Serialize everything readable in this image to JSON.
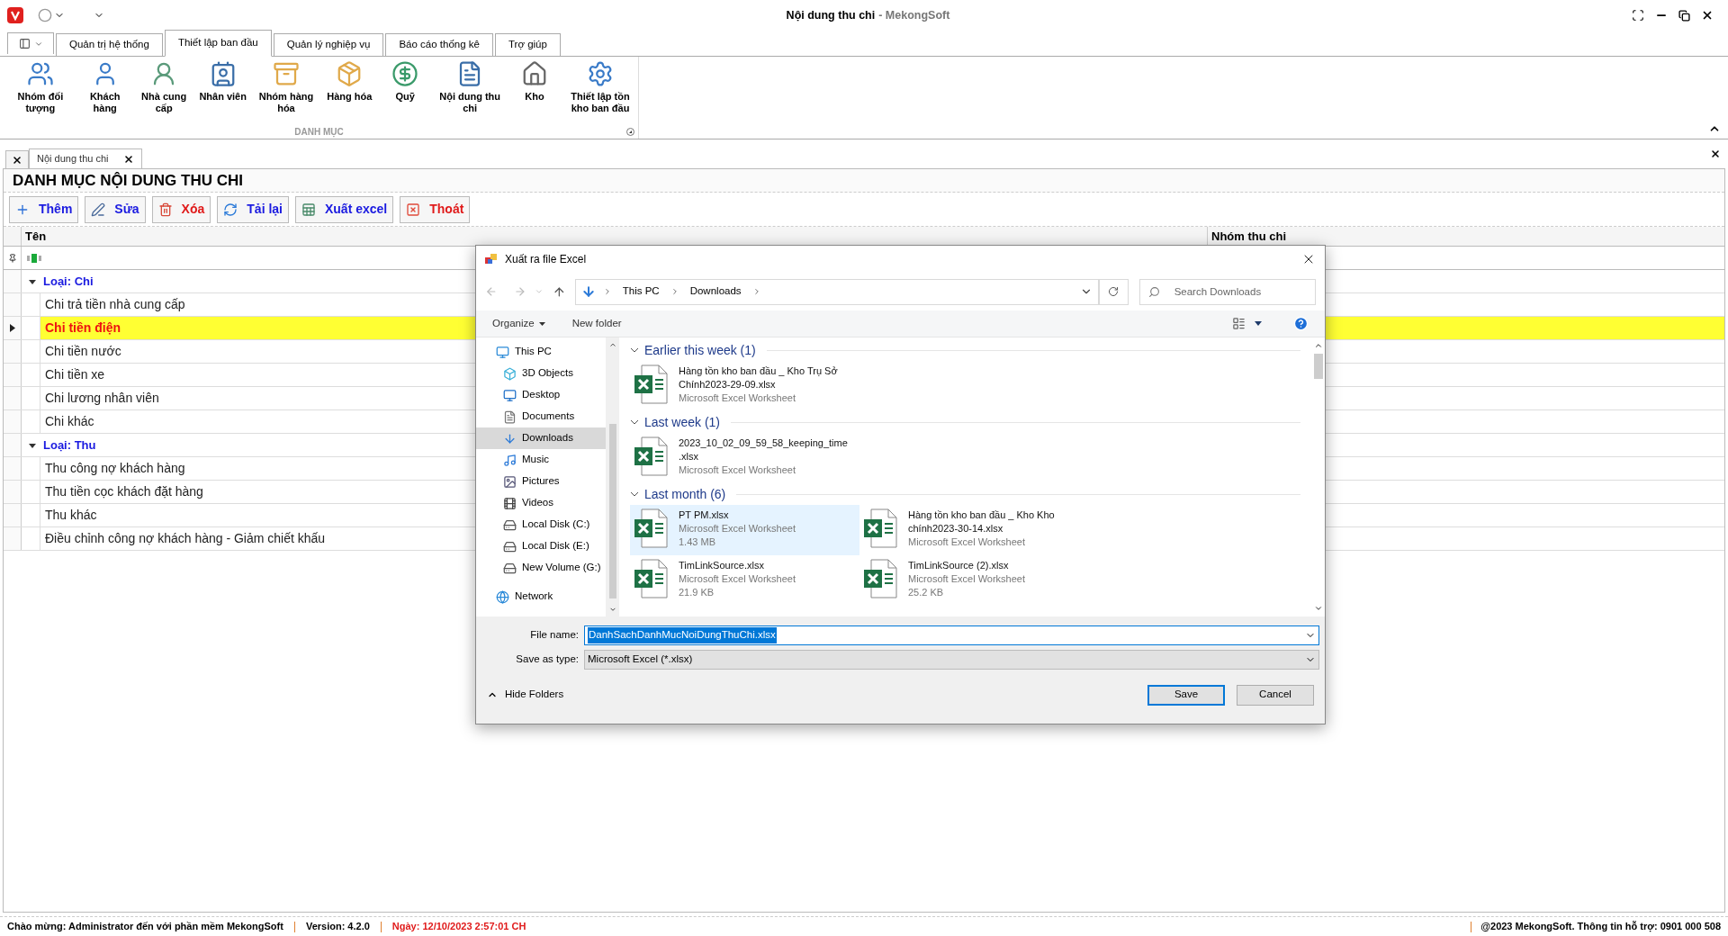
{
  "title_bar": {
    "title": "Nội dung thu chi",
    "app": "- MekongSoft"
  },
  "ribbon_tabs": [
    {
      "label": "Quản trị hệ thống",
      "selected": false
    },
    {
      "label": "Thiết lập ban đầu",
      "selected": true
    },
    {
      "label": "Quản lý nghiệp vụ",
      "selected": false
    },
    {
      "label": "Báo cáo thống kê",
      "selected": false
    },
    {
      "label": "Trợ giúp",
      "selected": false
    }
  ],
  "ribbon_buttons": [
    {
      "label": "Nhóm đối tượng"
    },
    {
      "label": "Khách hàng"
    },
    {
      "label": "Nhà cung cấp"
    },
    {
      "label": "Nhân viên"
    },
    {
      "label": "Nhóm hàng hóa"
    },
    {
      "label": "Hàng hóa"
    },
    {
      "label": "Quỹ"
    },
    {
      "label": "Nội dung thu chi"
    },
    {
      "label": "Kho"
    },
    {
      "label": "Thiết lập tồn kho ban đầu"
    }
  ],
  "ribbon_group": "DANH MỤC",
  "doc_tabs": [
    {
      "label": "Nội dung thu chi",
      "selected": true
    }
  ],
  "page_title": "DANH MỤC NỘI DUNG THU CHI",
  "toolbar": [
    {
      "label": "Thêm",
      "kind": "add"
    },
    {
      "label": "Sửa",
      "kind": "edit"
    },
    {
      "label": "Xóa",
      "kind": "delete"
    },
    {
      "label": "Tải lại",
      "kind": "reload"
    },
    {
      "label": "Xuất excel",
      "kind": "excel"
    },
    {
      "label": "Thoát",
      "kind": "exit"
    }
  ],
  "grid": {
    "columns": [
      "Tên",
      "Nhóm thu chi"
    ],
    "groups": [
      {
        "label": "Loại: Chi",
        "expanded": true,
        "rows": [
          {
            "name": "Chi trả tiền nhà cung cấp",
            "selected": false
          },
          {
            "name": "Chi tiền điện",
            "selected": true
          },
          {
            "name": "Chi tiền nước",
            "selected": false
          },
          {
            "name": "Chi tiền xe",
            "selected": false
          },
          {
            "name": "Chi lương nhân viên",
            "selected": false
          },
          {
            "name": "Chi khác",
            "selected": false
          }
        ]
      },
      {
        "label": "Loại: Thu",
        "expanded": true,
        "rows": [
          {
            "name": "Thu công nợ khách hàng",
            "selected": false
          },
          {
            "name": "Thu tiền cọc khách đặt hàng",
            "selected": false
          },
          {
            "name": "Thu khác",
            "selected": false
          },
          {
            "name": "Điều chỉnh công nợ khách hàng - Giảm chiết khấu",
            "selected": false
          }
        ]
      }
    ]
  },
  "dialog": {
    "title": "Xuất ra file Excel",
    "breadcrumb": [
      "This PC",
      "Downloads"
    ],
    "search": {
      "placeholder": "Search Downloads"
    },
    "organize": "Organize",
    "new_folder": "New folder",
    "nav": [
      {
        "label": "This PC",
        "selected": false,
        "top": true
      },
      {
        "label": "3D Objects",
        "selected": false,
        "top": false
      },
      {
        "label": "Desktop",
        "selected": false,
        "top": false
      },
      {
        "label": "Documents",
        "selected": false,
        "top": false
      },
      {
        "label": "Downloads",
        "selected": true,
        "top": false
      },
      {
        "label": "Music",
        "selected": false,
        "top": false
      },
      {
        "label": "Pictures",
        "selected": false,
        "top": false
      },
      {
        "label": "Videos",
        "selected": false,
        "top": false
      },
      {
        "label": "Local Disk (C:)",
        "selected": false,
        "top": false
      },
      {
        "label": "Local Disk (E:)",
        "selected": false,
        "top": false
      },
      {
        "label": "New Volume (G:)",
        "selected": false,
        "top": false
      },
      {
        "label": "Network",
        "selected": false,
        "top": true
      }
    ],
    "groups": [
      {
        "label": "Earlier this week (1)",
        "expanded": true,
        "files": [
          {
            "name": "Hàng tồn kho ban đầu _ Kho Trụ Sở Chính2023-29-09.xlsx",
            "type": "Microsoft Excel Worksheet",
            "selected": false
          }
        ]
      },
      {
        "label": "Last week (1)",
        "expanded": true,
        "files": [
          {
            "name": "2023_10_02_09_59_58_keeping_time .xlsx",
            "type": "Microsoft Excel Worksheet",
            "selected": false
          }
        ]
      },
      {
        "label": "Last month (6)",
        "expanded": true,
        "files": [
          {
            "name": "PT PM.xlsx",
            "type": "Microsoft Excel Worksheet",
            "size": "1.43 MB",
            "selected": true
          },
          {
            "name": "Hàng tồn kho ban đầu _ Kho Kho chính2023-30-14.xlsx",
            "type": "Microsoft Excel Worksheet",
            "selected": false
          },
          {
            "name": "TimLinkSource.xlsx",
            "type": "Microsoft Excel Worksheet",
            "size": "21.9 KB",
            "selected": false
          },
          {
            "name": "TimLinkSource (2).xlsx",
            "type": "Microsoft Excel Worksheet",
            "size": "25.2 KB",
            "selected": false
          }
        ]
      }
    ],
    "file_name_label": "File name:",
    "file_name": "DanhSachDanhMucNoiDungThuChi.xlsx",
    "save_type_label": "Save as type:",
    "save_type": "Microsoft Excel (*.xlsx)",
    "hide_folders": "Hide Folders",
    "buttons": [
      {
        "label": "Save",
        "kind": "primary"
      },
      {
        "label": "Cancel",
        "kind": "normal"
      }
    ]
  },
  "status_bar": {
    "welcome": "Chào mừng: Administrator đến với phần mềm MekongSoft",
    "version": "Version: 4.2.0",
    "date": "Ngày: 12/10/2023 2:57:01 CH",
    "support": "@2023 MekongSoft. Thông tin hỗ trợ: 0901 000 508"
  }
}
